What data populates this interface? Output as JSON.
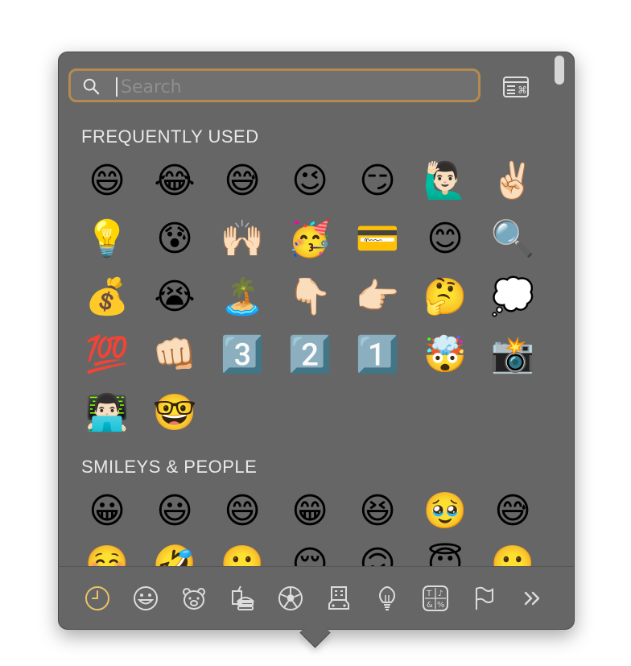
{
  "search": {
    "placeholder": "Search",
    "value": ""
  },
  "sections": {
    "frequently_used": {
      "title": "FREQUENTLY USED",
      "emojis": [
        "😄",
        "😂",
        "😅",
        "😉",
        "😏",
        "🙋🏻‍♂️",
        "✌🏻",
        "💡",
        "😰",
        "🙌🏻",
        "🥳",
        "💳",
        "😊",
        "🔍",
        "💰",
        "😭",
        "🏝️",
        "👇🏻",
        "👉🏻",
        "🤔",
        "💭",
        "💯",
        "👊🏻",
        "3️⃣",
        "2️⃣",
        "1️⃣",
        "🤯",
        "📸",
        "👨🏻‍💻",
        "🤓"
      ]
    },
    "smileys_people": {
      "title": "SMILEYS & PEOPLE",
      "emojis": [
        "😀",
        "😃",
        "😄",
        "😁",
        "😆",
        "🥹",
        "😅"
      ],
      "partial_row": [
        "☺️",
        "🤣",
        "🙂",
        "😌",
        "🙃",
        "😇",
        "🙂"
      ]
    }
  },
  "categories": [
    "Frequently Used",
    "Smileys & People",
    "Animals & Nature",
    "Food & Drink",
    "Activity",
    "Travel & Places",
    "Objects",
    "Symbols",
    "Flags",
    "More"
  ],
  "colors": {
    "panel": "#666666",
    "search_border": "#b58a50",
    "active_category": "#e9c46a"
  }
}
